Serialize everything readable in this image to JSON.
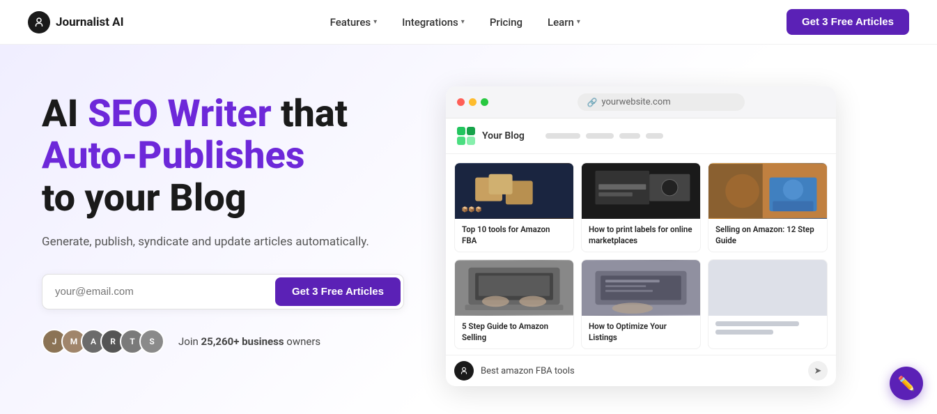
{
  "navbar": {
    "logo_text": "Journalist AI",
    "nav_items": [
      {
        "label": "Features",
        "has_dropdown": true
      },
      {
        "label": "Integrations",
        "has_dropdown": true
      },
      {
        "label": "Pricing",
        "has_dropdown": false
      },
      {
        "label": "Learn",
        "has_dropdown": true
      }
    ],
    "cta_label": "Get 3 Free Articles"
  },
  "hero": {
    "title_part1": "AI ",
    "title_purple": "SEO Writer",
    "title_part2": " that",
    "title_line2": "Auto-Publishes",
    "title_line3": "to your Blog",
    "subtitle": "Generate, publish, syndicate and update articles automatically.",
    "email_placeholder": "your@email.com",
    "cta_label": "Get 3 Free Articles",
    "social_proof": "Join ",
    "social_proof_bold": "25,260+ business",
    "social_proof_end": " owners"
  },
  "browser": {
    "url": "yourwebsite.com",
    "blog_title": "Your Blog",
    "search_query": "Best amazon FBA tools",
    "articles": [
      {
        "title": "Top 10 tools for Amazon FBA",
        "img_type": "amazon-boxes"
      },
      {
        "title": "How to print labels for online marketplaces",
        "img_type": "print-labels"
      },
      {
        "title": "Selling on Amazon: 12 Step Guide",
        "img_type": "delivery"
      },
      {
        "title": "5 Step Guide to Amazon Selling",
        "img_type": "laptop-hands"
      },
      {
        "title": "How to Optimize Your Listings",
        "img_type": "laptop-desk"
      },
      {
        "title": "",
        "img_type": "placeholder"
      }
    ]
  },
  "colors": {
    "primary_purple": "#6d28d9",
    "cta_purple": "#5b21b6"
  }
}
